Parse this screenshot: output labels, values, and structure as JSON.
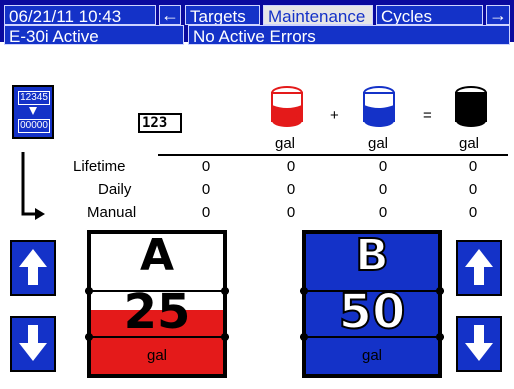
{
  "header": {
    "datetime": "06/21/11 10:43",
    "back_arrow": "←",
    "tabs": [
      {
        "label": "Targets",
        "active": false
      },
      {
        "label": "Maintenance",
        "active": true
      },
      {
        "label": "Cycles",
        "active": false
      }
    ],
    "forward_arrow": "→",
    "status_left": "E-30i Active",
    "status_right": "No Active Errors"
  },
  "reset_button": {
    "top_value": "12345",
    "bottom_value": "00000"
  },
  "counter_icon": {
    "text": "123"
  },
  "columns": [
    {
      "unit": "",
      "color": "#000000"
    },
    {
      "unit": "gal",
      "color": "#e41a1a"
    },
    {
      "unit": "gal",
      "color": "#1432c8"
    },
    {
      "unit": "gal",
      "color": "#000000"
    }
  ],
  "operators": {
    "plus": "+",
    "equals": "="
  },
  "rows": [
    {
      "label": "Lifetime",
      "values": [
        "0",
        "0",
        "0",
        "0"
      ]
    },
    {
      "label": "Daily",
      "values": [
        "0",
        "0",
        "0",
        "0"
      ]
    },
    {
      "label": "Manual",
      "values": [
        "0",
        "0",
        "0",
        "0"
      ]
    }
  ],
  "pump_a": {
    "letter": "A",
    "value": "25",
    "unit": "gal",
    "color": "#e41a1a"
  },
  "pump_b": {
    "letter": "B",
    "value": "50",
    "unit": "gal",
    "color": "#1432c8"
  },
  "icons": {
    "up_left": "arrow-up-icon",
    "down_left": "arrow-down-icon",
    "up_right": "arrow-up-icon",
    "down_right": "arrow-down-icon"
  }
}
